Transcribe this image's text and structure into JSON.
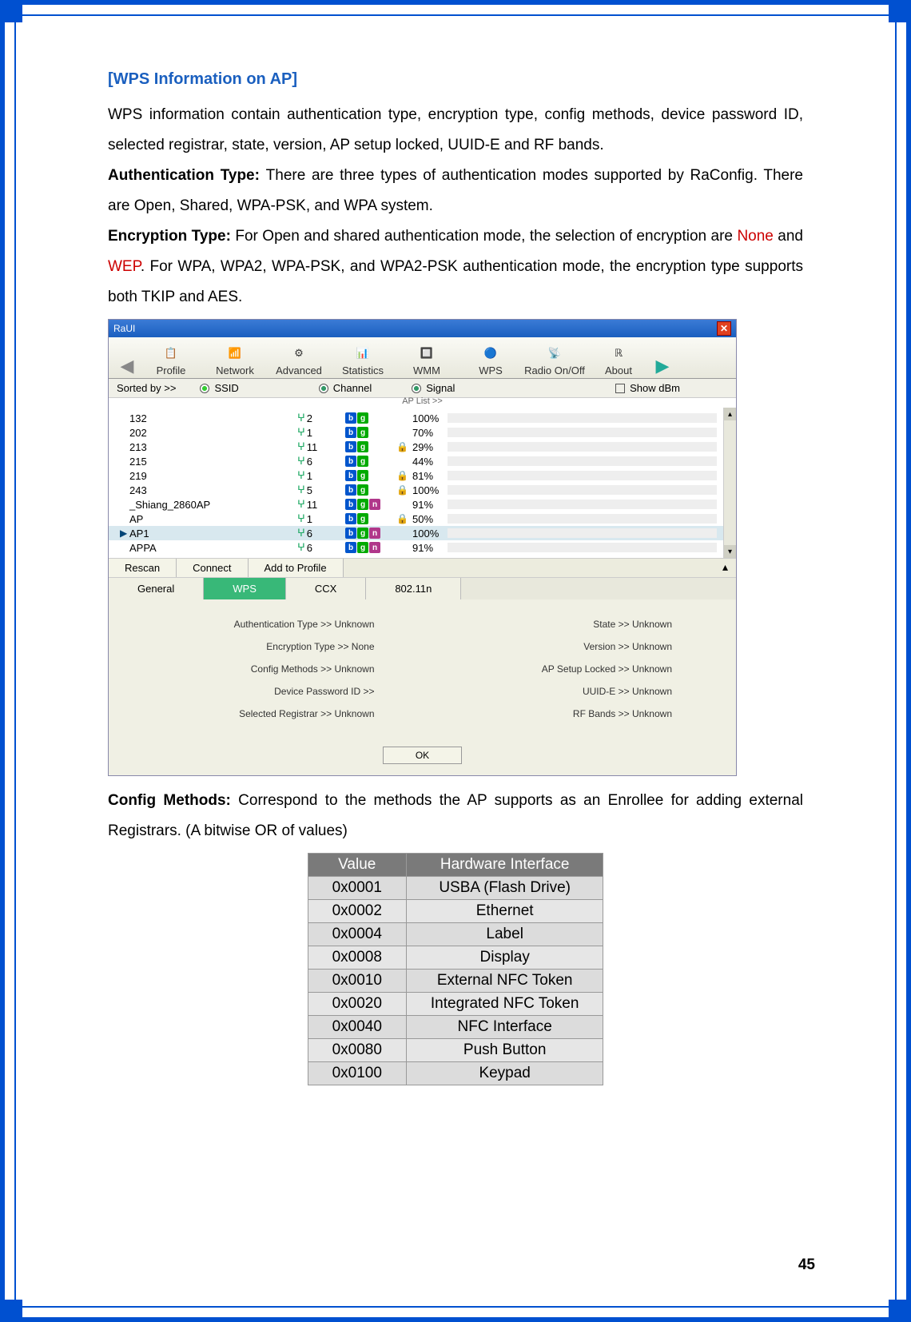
{
  "heading": "[WPS Information on AP]",
  "para1": "WPS information contain authentication type, encryption type, config methods, device password ID, selected registrar, state, version, AP setup locked, UUID-E and RF bands.",
  "auth_label": "Authentication Type: ",
  "auth_text": "There are three types of authentication modes supported by RaConfig. There are Open, Shared, WPA-PSK, and WPA system.",
  "enc_label": "Encryption Type: ",
  "enc_text1": "For Open and shared authentication mode, the selection of encryption are ",
  "enc_red1": "None",
  "enc_mid": " and ",
  "enc_red2": "WEP",
  "enc_text2": ". For WPA, WPA2, WPA-PSK, and WPA2-PSK authentication mode, the encryption type supports both TKIP and AES.",
  "cfg_label": "Config Methods: ",
  "cfg_text": "Correspond to the methods the AP supports as an Enrollee for adding external Registrars. (A bitwise OR of values)",
  "page_num": "45",
  "app": {
    "title": "RaUI",
    "toolbar": [
      "Profile",
      "Network",
      "Advanced",
      "Statistics",
      "WMM",
      "WPS",
      "Radio On/Off",
      "About"
    ],
    "sort_label": "Sorted by >>",
    "sort_ssid": "SSID",
    "sort_channel": "Channel",
    "sort_signal": "Signal",
    "show_dbm": "Show dBm",
    "aplist": "AP List >>",
    "rows": [
      {
        "ssid": "132",
        "ch": "2",
        "b": true,
        "g": true,
        "n": false,
        "lock": false,
        "sig": "100%",
        "pct": 100
      },
      {
        "ssid": "202",
        "ch": "1",
        "b": true,
        "g": true,
        "n": false,
        "lock": false,
        "sig": "70%",
        "pct": 70
      },
      {
        "ssid": "213",
        "ch": "11",
        "b": true,
        "g": true,
        "n": false,
        "lock": true,
        "sig": "29%",
        "pct": 29
      },
      {
        "ssid": "215",
        "ch": "6",
        "b": true,
        "g": true,
        "n": false,
        "lock": false,
        "sig": "44%",
        "pct": 44
      },
      {
        "ssid": "219",
        "ch": "1",
        "b": true,
        "g": true,
        "n": false,
        "lock": true,
        "sig": "81%",
        "pct": 81
      },
      {
        "ssid": "243",
        "ch": "5",
        "b": true,
        "g": true,
        "n": false,
        "lock": true,
        "sig": "100%",
        "pct": 100
      },
      {
        "ssid": "_Shiang_2860AP",
        "ch": "11",
        "b": true,
        "g": true,
        "n": true,
        "lock": false,
        "sig": "91%",
        "pct": 91
      },
      {
        "ssid": "AP",
        "ch": "1",
        "b": true,
        "g": true,
        "n": false,
        "lock": true,
        "sig": "50%",
        "pct": 50
      },
      {
        "ssid": "AP1",
        "ch": "6",
        "b": true,
        "g": true,
        "n": true,
        "lock": false,
        "sig": "100%",
        "pct": 100,
        "sel": true
      },
      {
        "ssid": "APPA",
        "ch": "6",
        "b": true,
        "g": true,
        "n": true,
        "lock": false,
        "sig": "91%",
        "pct": 91
      }
    ],
    "btns": [
      "Rescan",
      "Connect",
      "Add to Profile"
    ],
    "lower_tabs": [
      "General",
      "WPS",
      "CCX",
      "802.11n"
    ],
    "info_left": [
      "Authentication Type >> Unknown",
      "Encryption Type >> None",
      "Config Methods >> Unknown",
      "Device Password ID >>",
      "Selected Registrar >> Unknown"
    ],
    "info_right": [
      "State >> Unknown",
      "Version >> Unknown",
      "AP Setup Locked >> Unknown",
      "UUID-E >> Unknown",
      "RF Bands >> Unknown"
    ],
    "ok": "OK"
  },
  "table": {
    "headers": [
      "Value",
      "Hardware Interface"
    ],
    "rows": [
      [
        "0x0001",
        "USBA (Flash Drive)"
      ],
      [
        "0x0002",
        "Ethernet"
      ],
      [
        "0x0004",
        "Label"
      ],
      [
        "0x0008",
        "Display"
      ],
      [
        "0x0010",
        "External NFC Token"
      ],
      [
        "0x0020",
        "Integrated NFC Token"
      ],
      [
        "0x0040",
        "NFC Interface"
      ],
      [
        "0x0080",
        "Push Button"
      ],
      [
        "0x0100",
        "Keypad"
      ]
    ]
  }
}
